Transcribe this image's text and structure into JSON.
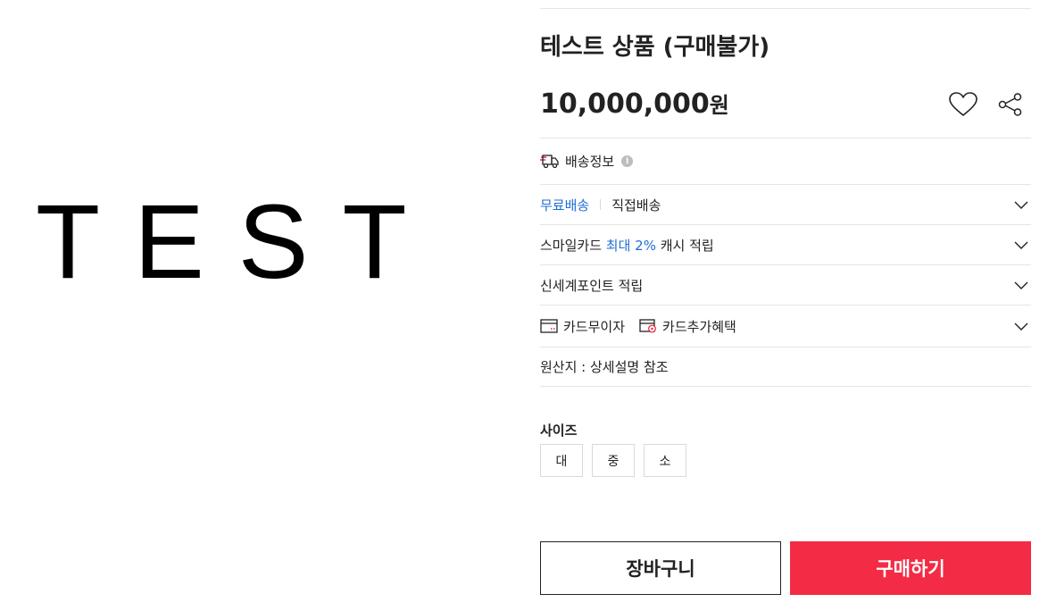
{
  "product_image": {
    "text": "TEST"
  },
  "product": {
    "title": "테스트 상품 (구매불가)",
    "price_number": "10,000,000",
    "price_unit": "원"
  },
  "actions": {
    "wish_icon": "heart-icon",
    "share_icon": "share-icon"
  },
  "delivery": {
    "title": "배송정보",
    "info_icon": "i"
  },
  "shipping": {
    "free": "무료배송",
    "direct": "직접배송"
  },
  "smilecard": {
    "prefix": "스마일카드 ",
    "highlight": "최대 2%",
    "suffix": " 캐시 적립"
  },
  "points": {
    "label": "신세계포인트 적립"
  },
  "card": {
    "installment": "카드무이자",
    "benefit": "카드추가혜택"
  },
  "origin": {
    "label": "원산지 : 상세설명 참조"
  },
  "size": {
    "label": "사이즈",
    "options": [
      "대",
      "중",
      "소"
    ]
  },
  "buttons": {
    "cart": "장바구니",
    "buy": "구매하기"
  },
  "colors": {
    "accent_blue": "#1f6fd1",
    "buy_red": "#f42b44",
    "delivery_icon_red": "#e8213a"
  }
}
